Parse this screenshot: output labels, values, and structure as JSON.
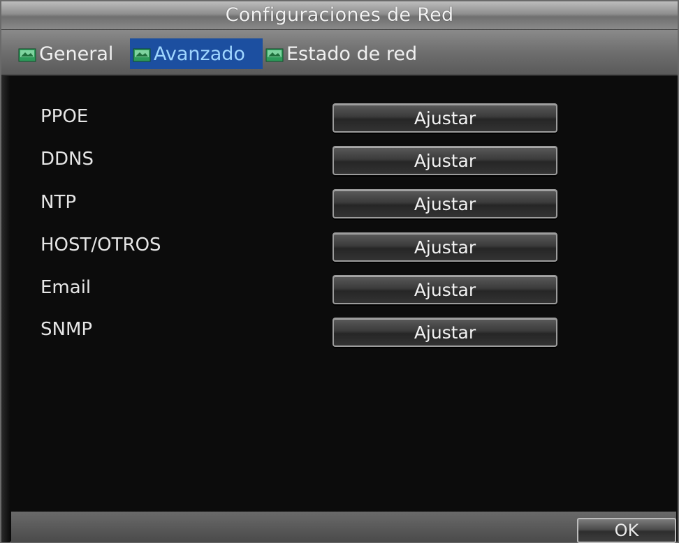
{
  "window": {
    "title": "Configuraciones de Red"
  },
  "tabs": [
    {
      "label": "General",
      "icon": "network-icon",
      "active": false
    },
    {
      "label": "Avanzado",
      "icon": "network-icon",
      "active": true
    },
    {
      "label": "Estado de red",
      "icon": "network-icon",
      "active": false
    }
  ],
  "settings": [
    {
      "label": "PPOE",
      "button_label": "Ajustar"
    },
    {
      "label": "DDNS",
      "button_label": "Ajustar"
    },
    {
      "label": "NTP",
      "button_label": "Ajustar"
    },
    {
      "label": "HOST/OTROS",
      "button_label": "Ajustar"
    },
    {
      "label": "Email",
      "button_label": "Ajustar"
    },
    {
      "label": "SNMP",
      "button_label": "Ajustar"
    }
  ],
  "footer": {
    "ok_label": "OK"
  },
  "colors": {
    "active_tab_bg": "#1c4fa0",
    "active_tab_text": "#9fd6ff",
    "background": "#0c0c0c"
  }
}
